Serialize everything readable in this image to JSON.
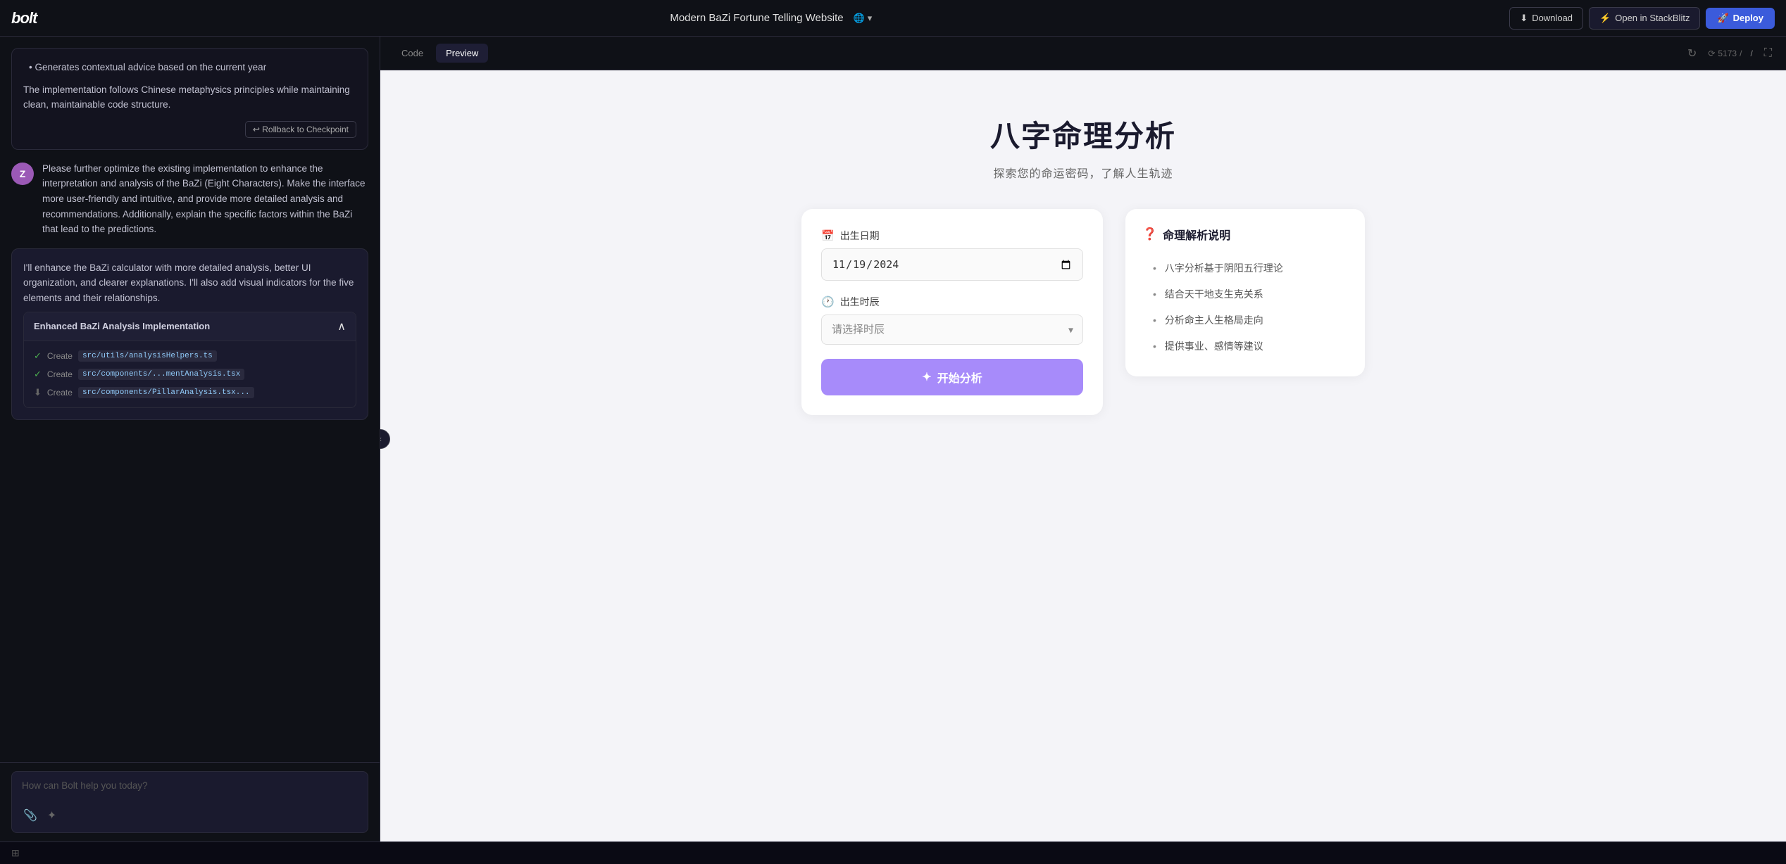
{
  "app": {
    "logo": "bolt",
    "project_title": "Modern BaZi Fortune Telling Website",
    "globe_label": "🌐",
    "chevron_down": "▾"
  },
  "topbar": {
    "download_label": "Download",
    "stackblitz_label": "Open in StackBlitz",
    "deploy_label": "Deploy",
    "lightning_icon": "⚡",
    "rocket_icon": "🚀",
    "download_icon": "⬇"
  },
  "chat": {
    "messages": [
      {
        "type": "assistant_bullet",
        "text": "Generates contextual advice based on the current year"
      },
      {
        "type": "assistant_paragraph",
        "text": "The implementation follows Chinese metaphysics principles while maintaining clean, maintainable code structure."
      },
      {
        "type": "rollback",
        "label": "↩ Rollback to Checkpoint"
      },
      {
        "type": "user",
        "avatar": "Z",
        "text": "Please further optimize the existing implementation to enhance the interpretation and analysis of the BaZi (Eight Characters). Make the interface more user-friendly and intuitive, and provide more detailed analysis and recommendations. Additionally, explain the specific factors within the BaZi that lead to the predictions."
      },
      {
        "type": "ai_response",
        "text": "I'll enhance the BaZi calculator with more detailed analysis, better UI organization, and clearer explanations. I'll also add visual indicators for the five elements and their relationships."
      }
    ],
    "impl_block": {
      "title": "Enhanced BaZi Analysis Implementation",
      "items": [
        {
          "status": "done",
          "action": "Create",
          "path": "src/utils/analysisHelpers.ts"
        },
        {
          "status": "done",
          "action": "Create",
          "path": "src/components/...mentAnalysis.tsx"
        },
        {
          "status": "in_progress",
          "action": "Create",
          "path": "src/components/PillarAnalysis.tsx..."
        }
      ]
    },
    "input_placeholder": "How can Bolt help you today?",
    "attachment_icon": "📎",
    "sparkle_icon": "✦"
  },
  "preview": {
    "tabs": [
      {
        "id": "code",
        "label": "Code",
        "active": false
      },
      {
        "id": "preview",
        "label": "Preview",
        "active": true
      }
    ],
    "token_count": "5173",
    "token_icon": "⟳",
    "url_path": "/",
    "expand_icon": "⛶",
    "refresh_icon": "↻"
  },
  "bazi_app": {
    "title": "八字命理分析",
    "subtitle": "探索您的命运密码，了解人生轨迹",
    "form": {
      "date_label": "出生日期",
      "date_icon": "📅",
      "date_value": "2024/11/19",
      "time_label": "出生时辰",
      "time_icon": "🕐",
      "time_placeholder": "请选择时辰",
      "analyze_button": "✦  开始分析",
      "analyze_icon": "✦"
    },
    "info_card": {
      "title": "命理解析说明",
      "title_icon": "❓",
      "items": [
        "八字分析基于阴阳五行理论",
        "结合天干地支生克关系",
        "分析命主人生格局走向",
        "提供事业、感情等建议"
      ]
    }
  },
  "bottom_bar": {
    "grid_icon": "⊞"
  }
}
